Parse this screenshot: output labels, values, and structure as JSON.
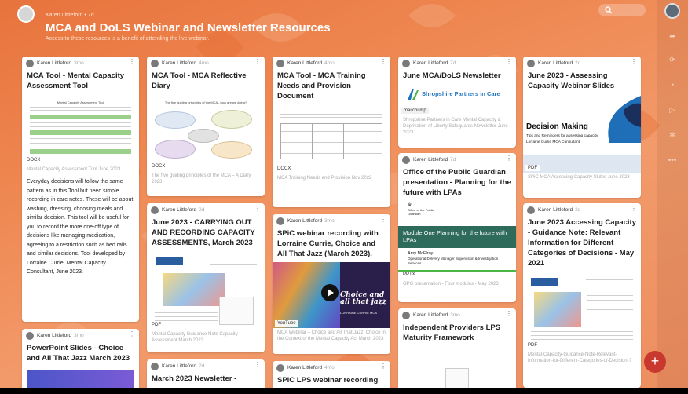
{
  "header": {
    "author": "Karen Littleford • 7d",
    "title": "MCA and DoLS Webinar and Newsletter Resources",
    "subtitle": "Access to these resources is a benefit of attending the live webinar."
  },
  "cards": {
    "c1": {
      "author": "Karen Littleford",
      "time": "3mo",
      "title": "MCA Tool - Mental Capacity Assessment Tool",
      "doc_heading": "Mental Capacity Assessment Tool",
      "file_type": "DOCX",
      "caption": "Mental Capacity Assessment Tool June 2023",
      "body": "Everyday decisions will follow the same pattern as in this Tool but need simple recording in care notes. These will be about washing, dressing, choosing meals and similar decision. This tool will be useful for you to record the more one-off type of decisions like managing medication, agreeing to a restriction such as bed rails and similar decisions. Tool developed by Lorraine Currie, Mental Capacity Consultant, June 2023."
    },
    "c2": {
      "author": "Karen Littleford",
      "time": "3mo",
      "title": "PowerPoint Slides - Choice and All That Jazz March 2023"
    },
    "c3": {
      "author": "Karen Littleford",
      "time": "4mo",
      "title": "MCA Tool - MCA Reflective Diary",
      "doc_heading": "The five guiding principles of the MCA - how are we doing?",
      "file_type": "DOCX",
      "caption": "The five guiding principles of the MCA – A Diary 2023"
    },
    "c4": {
      "author": "Karen Littleford",
      "time": "2d",
      "title": "June 2023 - CARRYING OUT AND RECORDING CAPACITY ASSESSMENTS, March 2023",
      "file_type": "PDF",
      "caption": "Mental Capacity Guidance Note Capacity Assessment March 2023"
    },
    "c5": {
      "author": "Karen Littleford",
      "time": "2d",
      "title": "March 2023 Newsletter -"
    },
    "c6": {
      "author": "Karen Littleford",
      "time": "4mo",
      "title": "MCA Tool - MCA Training Needs and Provision Document",
      "file_type": "DOCX",
      "caption": "MCA Training Needs and Provision Nov 2022"
    },
    "c7": {
      "author": "Karen Littleford",
      "time": "3mo",
      "title": "SPiC webinar recording with Lorraine Currie, Choice and All That Jazz (March 2023).",
      "video_title": "Choice and all that jazz",
      "video_sub": "LORRAINE CURRIE MCA",
      "file_type": "YouTube",
      "caption": "MCA Webinar – Choice and All That Jazz, Choice in the Context of the Mental Capacity Act March 2023"
    },
    "c8": {
      "author": "Karen Littleford",
      "time": "4mo",
      "title": "SPiC LPS webinar recording"
    },
    "c9": {
      "author": "Karen Littleford",
      "time": "7d",
      "title": "June MCA/DoLS Newsletter",
      "logo_text": "Shropshire Partners in Care",
      "domain": "mailchi.mp",
      "caption": "Shropshire Partners in Care Mental Capacity & Deprivation of Liberty Safeguards Newsletter June 2023"
    },
    "c10": {
      "author": "Karen Littleford",
      "time": "7d",
      "title": "Office of the Public Guardian presentation - Planning for the future with LPAs",
      "opg_name": "Office of the Public Guardian",
      "slide_title": "Module One Planning for the future with LPAs",
      "presenter": "Amy McElroy",
      "presenter_role": "Operational Delivery Manager Supervision & Investigation Services",
      "file_type": "PPTX",
      "caption": "OPG presentation - Four modules - May 2023"
    },
    "c11": {
      "author": "Karen Littleford",
      "time": "3mo",
      "title": "Independent Providers LPS Maturity Framework"
    },
    "c12": {
      "author": "Karen Littleford",
      "time": "2d",
      "title": "June 2023 - Assessing Capacity Webinar Slides",
      "slide_title": "Decision Making",
      "slide_sub": "Tips and Reminders for assessing capacity",
      "slide_author": "Lorraine Currie MCA Consultant",
      "file_type": "PDF",
      "caption": "SPiC MCA Assessing Capacity Slides June 2023"
    },
    "c13": {
      "author": "Karen Littleford",
      "time": "2d",
      "title": "June 2023 Accessing Capacity - Guidance Note: Relevant Information for Different Categories of Decisions - May 2021",
      "file_type": "PDF",
      "caption": "Mental-Capacity-Guidance-Note-Relevant-Information-for-Different-Categories-of-Decision-?"
    }
  },
  "fab": {
    "label": "+"
  },
  "colors": {
    "accent": "#c8382e",
    "background": "#ee8550",
    "opg_green": "#2f6b5a",
    "logo_blue": "#1e73be"
  }
}
